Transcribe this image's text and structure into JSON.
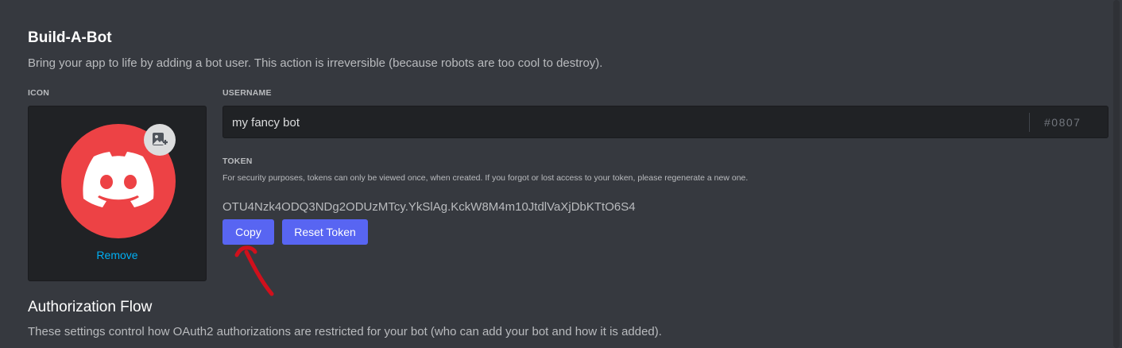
{
  "section": {
    "title": "Build-A-Bot",
    "description": "Bring your app to life by adding a bot user. This action is irreversible (because robots are too cool to destroy)."
  },
  "icon": {
    "label": "ICON",
    "remove_label": "Remove",
    "avatar_icon": "discord-logo-icon",
    "avatar_color": "#ed4245",
    "upload_icon": "image-add-icon"
  },
  "username": {
    "label": "USERNAME",
    "value": "my fancy bot",
    "discriminator": "#0807"
  },
  "token": {
    "label": "TOKEN",
    "help": "For security purposes, tokens can only be viewed once, when created. If you forgot or lost access to your token, please regenerate a new one.",
    "value": "OTU4Nzk4ODQ3NDg2ODUzMTcy.YkSlAg.KckW8M4m10JtdlVaXjDbKTtO6S4",
    "copy_label": "Copy",
    "reset_label": "Reset Token",
    "button_color": "#5865f2"
  },
  "auth_flow": {
    "title": "Authorization Flow",
    "description": "These settings control how OAuth2 authorizations are restricted for your bot (who can add your bot and how it is added)."
  },
  "annotation": {
    "arrow_color": "#d0101c"
  }
}
